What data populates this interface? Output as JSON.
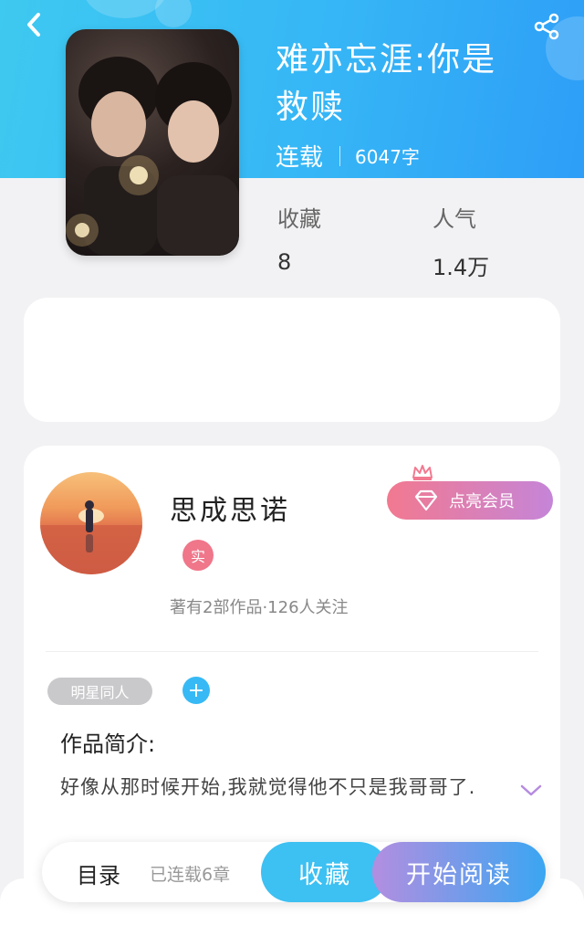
{
  "book": {
    "title": "难亦忘涯:你是救赎",
    "status": "连载",
    "word_count": "6047字"
  },
  "stats": {
    "favorites_label": "收藏",
    "favorites_value": "8",
    "popularity_label": "人气",
    "popularity_value": "1.4万"
  },
  "author": {
    "name": "思成思诺",
    "real_badge": "实",
    "vip_button": "点亮会员",
    "meta": "著有2部作品·126人关注"
  },
  "tags": [
    "明星同人"
  ],
  "intro": {
    "title": "作品简介:",
    "text": "好像从那时候开始,我就觉得他不只是我哥哥了."
  },
  "bottom_bar": {
    "toc": "目录",
    "chapters": "已连载6章",
    "favorite_button": "收藏",
    "read_button": "开始阅读"
  },
  "colors": {
    "header_start": "#3ec9f0",
    "header_end": "#2e9ef7",
    "vip_start": "#f27990",
    "vip_end": "#c585d8",
    "favorite_button": "#3dc0f2",
    "read_start": "#b38ee0",
    "read_end": "#3aa6f2",
    "tag_add": "#37b9f5"
  },
  "icons": {
    "back": "chevron-left-icon",
    "share": "share-icon",
    "vip": "diamond-icon",
    "crown": "crown-icon",
    "add": "plus-icon",
    "expand": "chevron-down-icon"
  }
}
